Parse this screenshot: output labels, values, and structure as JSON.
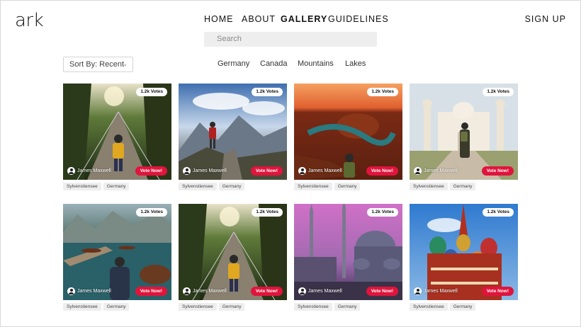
{
  "brand": {
    "logo": "ark"
  },
  "nav": {
    "home": "HOME",
    "about": "ABOUT",
    "gallery": "GALLERY",
    "guidelines": "GUIDELINES"
  },
  "auth": {
    "signup": "SIGN UP"
  },
  "search": {
    "placeholder": "Search"
  },
  "sort": {
    "label": "Sort By: Recent"
  },
  "filters": [
    "Germany",
    "Canada",
    "Mountains",
    "Lakes"
  ],
  "colors": {
    "accent": "#e0143c",
    "tag_bg": "#eeeeee",
    "search_bg": "#eeeeee"
  },
  "cards": [
    {
      "votes": "1.2k Votes",
      "author": "James Maxwell",
      "vote_label": "Vote Now!",
      "tags": [
        "Sylvenstiensee",
        "Germany"
      ],
      "scene": "forest-bridge"
    },
    {
      "votes": "1.2k Votes",
      "author": "James Maxwell",
      "vote_label": "Vote Now!",
      "tags": [
        "Sylvenstiensee",
        "Germany"
      ],
      "scene": "mountain-hiker"
    },
    {
      "votes": "1.2k Votes",
      "author": "James Maxwell",
      "vote_label": "Vote Now!",
      "tags": [
        "Sylvenstiensee",
        "Germany"
      ],
      "scene": "canyon-sunset"
    },
    {
      "votes": "1.2k Votes",
      "author": "James Maxwell",
      "vote_label": "Vote Now!",
      "tags": [
        "Sylvenstiensee",
        "Germany"
      ],
      "scene": "taj-mahal"
    },
    {
      "votes": "1.2k Votes",
      "author": "James Maxwell",
      "vote_label": "Vote Now!",
      "tags": [
        "Sylvenstiensee",
        "Germany"
      ],
      "scene": "lake-boats"
    },
    {
      "votes": "1.2k Votes",
      "author": "James Maxwell",
      "vote_label": "Vote Now!",
      "tags": [
        "Sylvenstiensee",
        "Germany"
      ],
      "scene": "forest-bridge"
    },
    {
      "votes": "1.2k Votes",
      "author": "James Maxwell",
      "vote_label": "Vote Now!",
      "tags": [
        "Sylvenstiensee",
        "Germany"
      ],
      "scene": "mosque-dusk"
    },
    {
      "votes": "1.2k Votes",
      "author": "James Maxwell",
      "vote_label": "Vote Now!",
      "tags": [
        "Sylvenstiensee",
        "Germany"
      ],
      "scene": "st-basil"
    }
  ]
}
